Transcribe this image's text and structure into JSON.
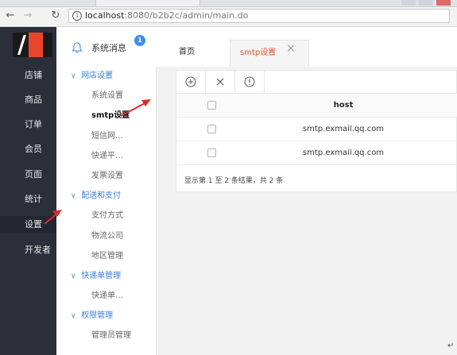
{
  "browser": {
    "back_icon": "arrow-left-icon",
    "forward_icon": "arrow-right-icon",
    "reload_icon": "reload-icon",
    "url_host": "localhost",
    "url_rest": ":8080/b2b2c/admin/main.do"
  },
  "leftnav": {
    "items": [
      {
        "label": "店铺"
      },
      {
        "label": "商品"
      },
      {
        "label": "订单"
      },
      {
        "label": "会员"
      },
      {
        "label": "页面"
      },
      {
        "label": "统计"
      },
      {
        "label": "设置"
      },
      {
        "label": "开发者"
      }
    ],
    "active_index": 6
  },
  "header": {
    "messages_label": "系统消息",
    "badge_count": "1",
    "tabs": [
      {
        "label": "首页"
      },
      {
        "label": "smtp设置"
      }
    ],
    "active_tab_color": "#e8512f"
  },
  "submenu": {
    "groups": [
      {
        "label": "网店设置",
        "items": [
          "系统设置",
          "smtp设置",
          "短信网…",
          "快递平…",
          "发票设置"
        ]
      },
      {
        "label": "配送和支付",
        "items": [
          "支付方式",
          "物流公司",
          "地区管理"
        ]
      },
      {
        "label": "快递单管理",
        "items": [
          "快递单…"
        ]
      },
      {
        "label": "权限管理",
        "items": [
          "管理员管理"
        ]
      }
    ],
    "active_item": "smtp设置"
  },
  "table": {
    "toolbar_icons": [
      "add-circle-icon",
      "delete-x-icon",
      "info-circle-icon"
    ],
    "column_header": "host",
    "rows": [
      {
        "host": "smtp.exmail.qq.com"
      },
      {
        "host": "smtp.exmail.qq.com"
      }
    ],
    "summary": "显示第 1 至 2 条结果，共 2 条"
  },
  "colors": {
    "sidebar_bg": "#2b2f3a",
    "accent_red": "#e8512f",
    "group_blue": "#3d7fd6",
    "badge_blue": "#3d8ee8"
  }
}
